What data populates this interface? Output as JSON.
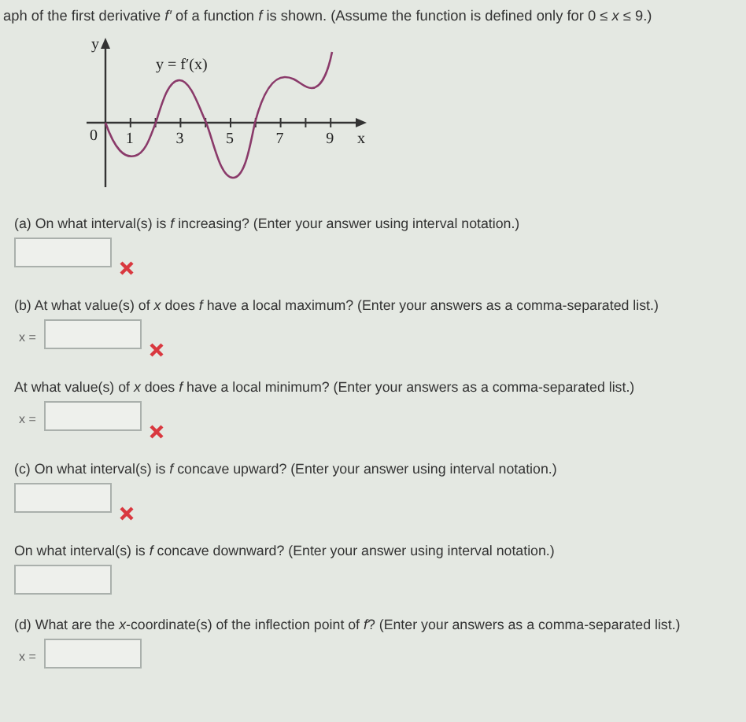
{
  "intro": "aph of the first derivative *f′* of a function *f* is shown. (Assume the function is defined only for 0 ≤ *x* ≤ 9.)",
  "graph": {
    "y_axis_label": "y",
    "x_axis_label": "x",
    "curve_label": "y = f′(x)",
    "origin_label": "0",
    "tick_labels": [
      "1",
      "3",
      "5",
      "7",
      "9"
    ]
  },
  "questions": [
    {
      "prompt": "(a) On what interval(s) is *f* increasing? (Enter your answer using interval notation.)",
      "marked_wrong": true
    },
    {
      "prompt": "(b) At what value(s) of *x* does *f* have a local maximum? (Enter your answers as a comma-separated list.)",
      "prefix": "x =",
      "marked_wrong": true
    },
    {
      "prompt": "At what value(s) of *x* does *f* have a local minimum? (Enter your answers as a comma-separated list.)",
      "prefix": "x =",
      "marked_wrong": true
    },
    {
      "prompt": "(c) On what interval(s) is *f* concave upward? (Enter your answer using interval notation.)",
      "marked_wrong": true
    },
    {
      "prompt": "On what interval(s) is *f* concave downward? (Enter your answer using interval notation.)",
      "marked_wrong": false
    },
    {
      "prompt": "(d) What are the *x*-coordinate(s) of the inflection point of *f*? (Enter your answers as a comma-separated list.)",
      "prefix": "x =",
      "marked_wrong": false
    }
  ]
}
